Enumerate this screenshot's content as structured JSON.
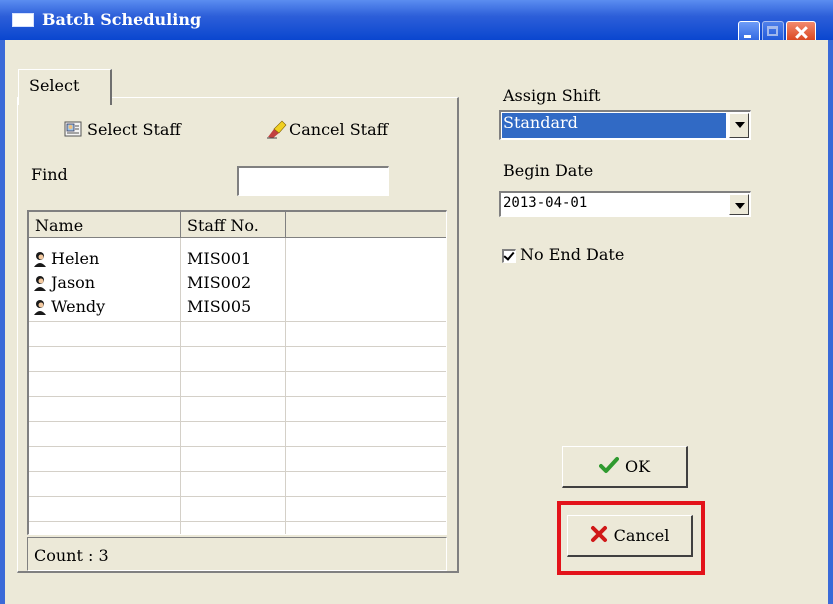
{
  "window": {
    "title": "Batch Scheduling"
  },
  "tab": {
    "label": "Select"
  },
  "toolbar": {
    "select_staff": "Select Staff",
    "cancel_staff": "Cancel Staff"
  },
  "find": {
    "label": "Find",
    "value": ""
  },
  "list": {
    "columns": [
      "Name",
      "Staff No."
    ],
    "rows": [
      {
        "name": "Helen",
        "staff_no": "MIS001"
      },
      {
        "name": "Jason",
        "staff_no": "MIS002"
      },
      {
        "name": "Wendy",
        "staff_no": "MIS005"
      }
    ]
  },
  "count": {
    "text": "Count : 3"
  },
  "assign_shift": {
    "label": "Assign Shift",
    "value": "Standard"
  },
  "begin_date": {
    "label": "Begin Date",
    "value": "2013-04-01"
  },
  "no_end_date": {
    "label": "No End Date",
    "checked": true
  },
  "buttons": {
    "ok": "OK",
    "cancel": "Cancel"
  },
  "colors": {
    "titlebar": "#0a46cf",
    "highlight": "#e3121a",
    "dialog": "#ece9d8"
  }
}
